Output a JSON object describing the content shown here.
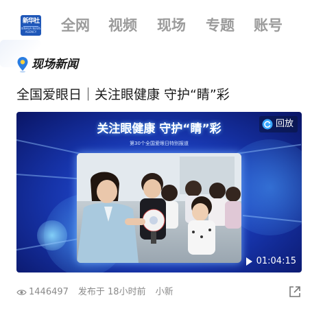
{
  "nav": {
    "logo_text": "新华社",
    "logo_subtext": "XINHUA NEWS AGENCY",
    "items": [
      {
        "label": "全网"
      },
      {
        "label": "视频"
      },
      {
        "label": "现场"
      },
      {
        "label": "专题"
      },
      {
        "label": "账号"
      }
    ]
  },
  "section": {
    "label": "现场新闻",
    "icon": "location-pin-icon"
  },
  "article": {
    "headline": "全国爱眼日｜关注眼健康 守护“睛”彩",
    "video": {
      "title": "关注眼健康  守护“睛”彩",
      "subtitle": "第30个全国爱眼日特别报道",
      "replay_label": "回放",
      "duration": "01:04:15"
    },
    "views": "1446497",
    "published": "发布于 18小时前",
    "author": "小新"
  },
  "colors": {
    "accent": "#1f57b8",
    "video_bg": "#1633a8",
    "pin": "#2a7de1"
  }
}
